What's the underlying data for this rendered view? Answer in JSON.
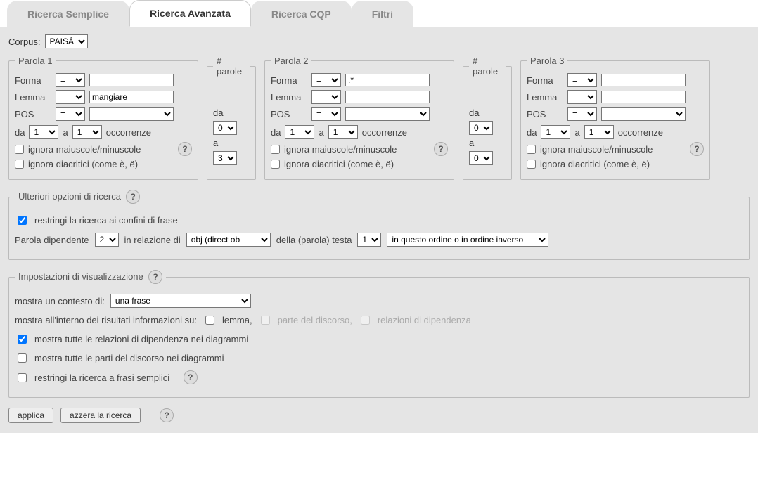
{
  "tabs": {
    "simple": "Ricerca Semplice",
    "advanced": "Ricerca Avanzata",
    "cqp": "Ricerca CQP",
    "filters": "Filtri"
  },
  "corpus": {
    "label": "Corpus:",
    "value": "PAISÀ"
  },
  "word1": {
    "legend": "Parola 1",
    "forma_label": "Forma",
    "forma_op": "=",
    "forma_val": "",
    "lemma_label": "Lemma",
    "lemma_op": "=",
    "lemma_val": "mangiare",
    "pos_label": "POS",
    "pos_op": "=",
    "pos_val": "",
    "occ_da": "da",
    "occ_da_val": "1",
    "occ_a": "a",
    "occ_a_val": "1",
    "occ_label": "occorrenze",
    "ignore_case": "ignora maiuscole/minuscole",
    "ignore_diacritics": "ignora diacritici (come è, ë)"
  },
  "gap1": {
    "legend": "# parole",
    "da": "da",
    "da_val": "0",
    "a": "a",
    "a_val": "3"
  },
  "word2": {
    "legend": "Parola 2",
    "forma_label": "Forma",
    "forma_op": "=",
    "forma_val": ".*",
    "lemma_label": "Lemma",
    "lemma_op": "=",
    "lemma_val": "",
    "pos_label": "POS",
    "pos_op": "=",
    "pos_val": "",
    "occ_da": "da",
    "occ_da_val": "1",
    "occ_a": "a",
    "occ_a_val": "1",
    "occ_label": "occorrenze",
    "ignore_case": "ignora maiuscole/minuscole",
    "ignore_diacritics": "ignora diacritici (come è, ë)"
  },
  "gap2": {
    "legend": "# parole",
    "da": "da",
    "da_val": "0",
    "a": "a",
    "a_val": "0"
  },
  "word3": {
    "legend": "Parola 3",
    "forma_label": "Forma",
    "forma_op": "=",
    "forma_val": "",
    "lemma_label": "Lemma",
    "lemma_op": "=",
    "lemma_val": "",
    "pos_label": "POS",
    "pos_op": "=",
    "pos_val": "",
    "occ_da": "da",
    "occ_da_val": "1",
    "occ_a": "a",
    "occ_a_val": "1",
    "occ_label": "occorrenze",
    "ignore_case": "ignora maiuscole/minuscole",
    "ignore_diacritics": "ignora diacritici (come è, ë)"
  },
  "options": {
    "legend": "Ulteriori opzioni di ricerca",
    "restrict_sentence": "restringi la ricerca ai confini di frase",
    "dep_word": "Parola dipendente",
    "dep_val": "2",
    "rel_text": "in relazione di",
    "rel_val": "obj (direct ob",
    "head_text": "della (parola) testa",
    "head_val": "1",
    "order_val": "in questo ordine o in ordine inverso"
  },
  "display": {
    "legend": "Impostazioni di visualizzazione",
    "context_label": "mostra un contesto di:",
    "context_val": "una frase",
    "info_intro": "mostra all'interno dei risultati informazioni su:",
    "lemma": "lemma,",
    "pos": "parte del discorso,",
    "deprel": "relazioni di dipendenza",
    "show_all_dep": "mostra tutte le relazioni di dipendenza nei diagrammi",
    "show_all_pos": "mostra tutte le parti del discorso nei diagrammi",
    "restrict_simple": "restringi la ricerca a frasi semplici"
  },
  "buttons": {
    "apply": "applica",
    "reset": "azzera la ricerca"
  },
  "help_icon": "?"
}
